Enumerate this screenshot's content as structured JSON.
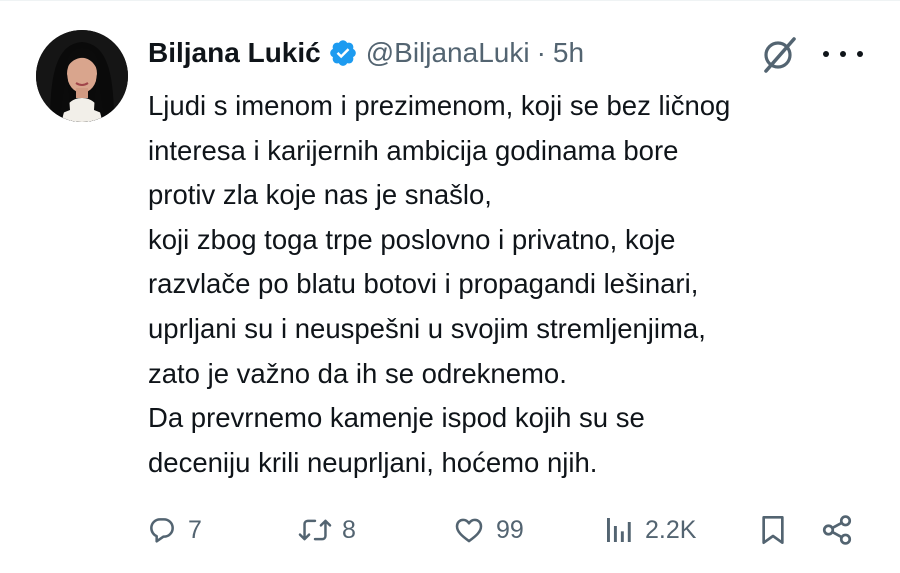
{
  "author": {
    "display_name": "Biljana Lukić",
    "handle": "@BiljanaLuki",
    "separator": "·",
    "time": "5h",
    "verified": true
  },
  "icons": {
    "verified": "verified-badge-icon",
    "grok": "grok-icon",
    "more": "more-options-icon",
    "reply": "reply-icon",
    "retweet": "retweet-icon",
    "like": "heart-icon",
    "views": "views-chart-icon",
    "bookmark": "bookmark-icon",
    "share": "share-icon"
  },
  "colors": {
    "verified_blue": "#1d9bf0",
    "text_primary": "#0f1419",
    "text_secondary": "#536471"
  },
  "tweet": {
    "lines": [
      "Ljudi s imenom i prezimenom, koji se bez ličnog",
      "interesa i karijernih ambicija godinama bore",
      "protiv zla koje nas je snašlo,",
      "koji zbog toga trpe poslovno i privatno, koje",
      "razvlače po blatu botovi i propagandi lešinari,",
      "uprljani su i neuspešni u svojim stremljenjima,",
      "zato je važno da ih se odreknemo.",
      "Da prevrnemo kamenje ispod kojih su se",
      "deceniju krili neuprljani, hoćemo njih."
    ]
  },
  "stats": {
    "replies": "7",
    "retweets": "8",
    "likes": "99",
    "views": "2.2K"
  }
}
